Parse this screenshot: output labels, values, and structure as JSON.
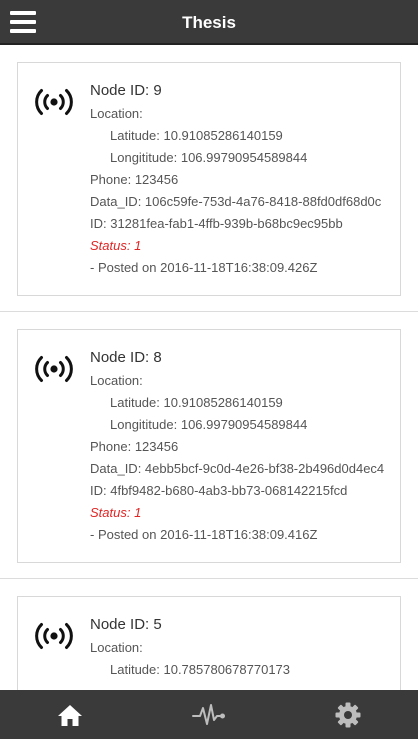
{
  "header": {
    "title": "Thesis"
  },
  "labels": {
    "node_id_prefix": "Node ID: ",
    "location": "Location:",
    "latitude_prefix": "Latitude: ",
    "longitude_prefix": "Longititude: ",
    "phone_prefix": "Phone: ",
    "data_id_prefix": "Data_ID: ",
    "id_prefix": "ID: ",
    "status_prefix": "Status: ",
    "posted_prefix": "- Posted on "
  },
  "nodes": [
    {
      "node_id": "Node ID: 9",
      "location": "Location:",
      "latitude": "Latitude: 10.91085286140159",
      "longitude": "Longititude: 106.99790954589844",
      "phone": "Phone: 123456",
      "data_id": "Data_ID: 106c59fe-753d-4a76-8418-88fd0df68d0c",
      "id": "ID: 31281fea-fab1-4ffb-939b-b68bc9ec95bb",
      "status": "Status: 1",
      "posted": "- Posted on 2016-11-18T16:38:09.426Z"
    },
    {
      "node_id": "Node ID: 8",
      "location": "Location:",
      "latitude": "Latitude: 10.91085286140159",
      "longitude": "Longititude: 106.99790954589844",
      "phone": "Phone: 123456",
      "data_id": "Data_ID: 4ebb5bcf-9c0d-4e26-bf38-2b496d0d4ec4",
      "id": "ID: 4fbf9482-b680-4ab3-bb73-068142215fcd",
      "status": "Status: 1",
      "posted": "- Posted on 2016-11-18T16:38:09.416Z"
    },
    {
      "node_id": "Node ID: 5",
      "location": "Location:",
      "latitude": "Latitude: 10.785780678770173",
      "longitude": "",
      "phone": "",
      "data_id": "",
      "id": "",
      "status": "",
      "posted": ""
    }
  ],
  "nav": {
    "items": [
      {
        "icon": "home-icon"
      },
      {
        "icon": "activity-pulse-icon"
      },
      {
        "icon": "gear-icon"
      }
    ]
  },
  "colors": {
    "header_bg": "#3a3a3a",
    "status_red": "#e02525",
    "nav_bg": "#3a3a3a"
  }
}
